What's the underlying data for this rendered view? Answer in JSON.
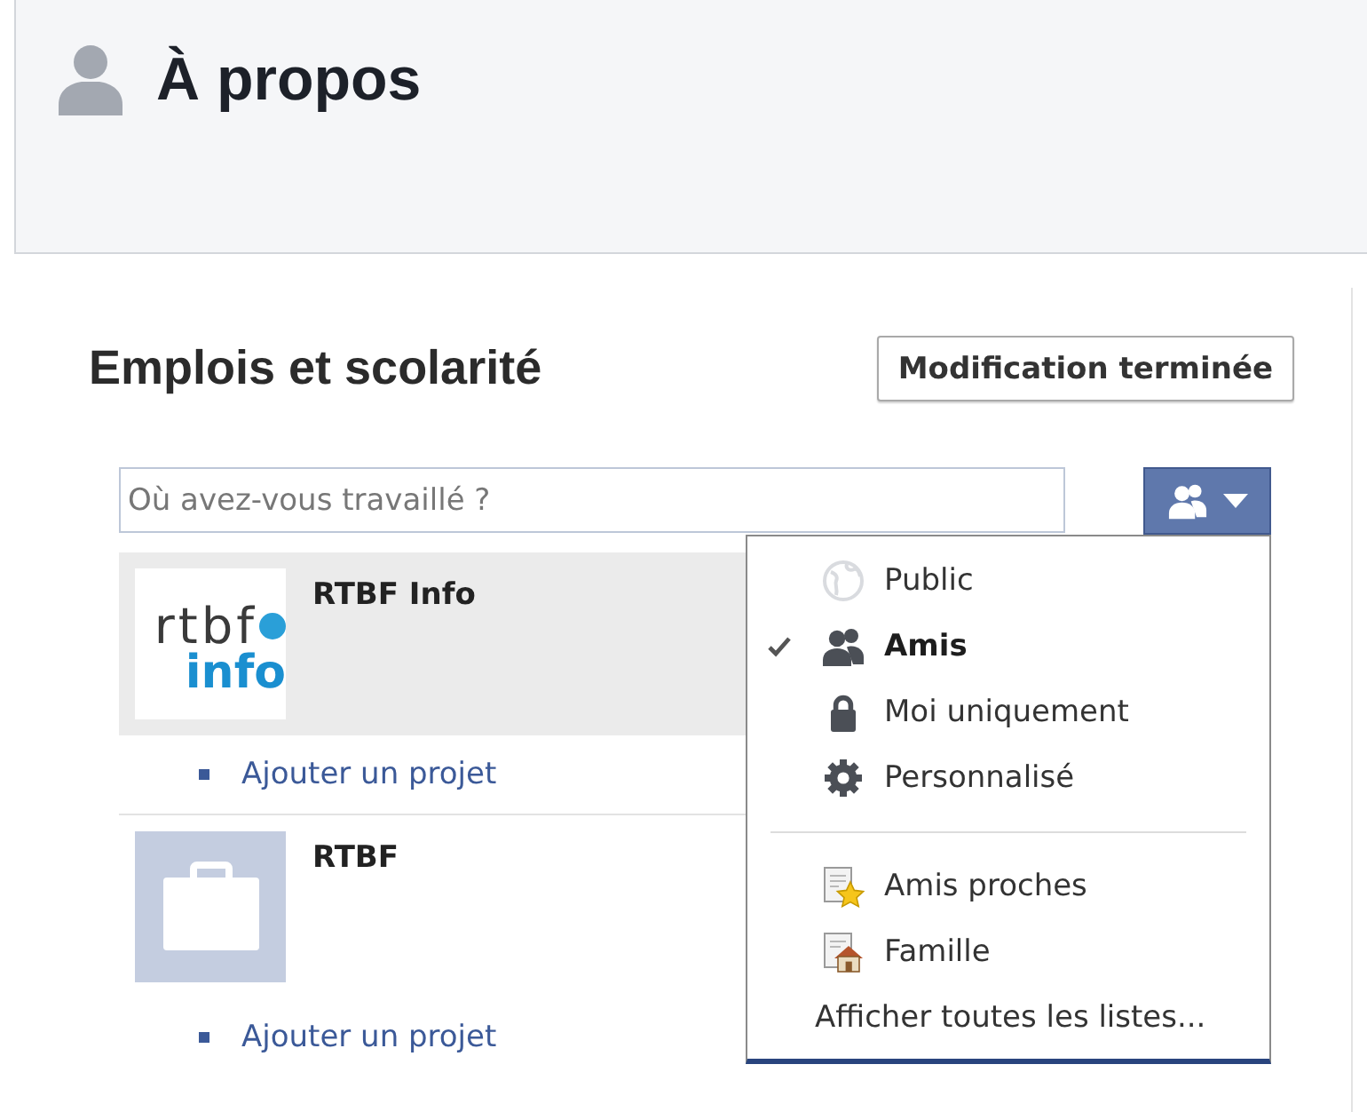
{
  "header": {
    "title": "À propos"
  },
  "section": {
    "title": "Emplois et scolarité",
    "done_button": "Modification terminée"
  },
  "work_field": {
    "placeholder": "Où avez-vous travaillé ?"
  },
  "privacy_button": {
    "expanded": true
  },
  "privacy_menu": {
    "audiences": [
      {
        "kind": "public",
        "label": "Public",
        "selected": false
      },
      {
        "kind": "friends",
        "label": "Amis",
        "selected": true
      },
      {
        "kind": "only_me",
        "label": "Moi uniquement",
        "selected": false
      },
      {
        "kind": "custom",
        "label": "Personnalisé",
        "selected": false
      }
    ],
    "lists": [
      {
        "kind": "close_friends",
        "label": "Amis proches",
        "selected": false
      },
      {
        "kind": "family",
        "label": "Famille",
        "selected": false
      }
    ],
    "show_all": "Afficher toutes les listes..."
  },
  "workplaces": [
    {
      "name": "RTBF Info",
      "thumbnail": {
        "kind": "logo",
        "lines": [
          "rtbf",
          "info"
        ]
      },
      "highlighted": true,
      "add_project": "Ajouter un projet"
    },
    {
      "name": "RTBF",
      "thumbnail": {
        "kind": "placeholder"
      },
      "highlighted": false,
      "add_project": "Ajouter un projet"
    }
  ]
}
